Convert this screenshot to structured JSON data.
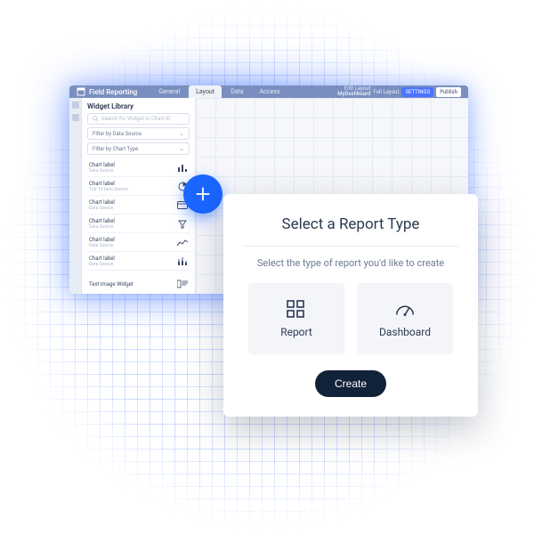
{
  "app": {
    "title": "Field Reporting",
    "tabs": [
      "General",
      "Layout",
      "Data",
      "Access"
    ],
    "active_tab": "Layout",
    "workspace": {
      "label_top": "Edit Layout",
      "name": "MyDashboard"
    },
    "header_buttons": {
      "full": "Full Layout",
      "settings": "SETTINGS",
      "publish": "Publish"
    }
  },
  "sidebar": {
    "title": "Widget Library",
    "search_placeholder": "Search for Widget or Chart ID",
    "filter_source": "Filter by Data Source",
    "filter_chart": "Filter by Chart Type",
    "items": [
      {
        "label": "Chart label",
        "sub": "Data Source",
        "icon": "bar"
      },
      {
        "label": "Chart label",
        "sub": "Top 10 Data Source",
        "icon": "pie"
      },
      {
        "label": "Chart label",
        "sub": "Data Source",
        "icon": "card"
      },
      {
        "label": "Chart label",
        "sub": "Data Source",
        "icon": "funnel"
      },
      {
        "label": "Chart label",
        "sub": "Data Source",
        "icon": "line"
      },
      {
        "label": "Chart label",
        "sub": "Data Source",
        "icon": "stack"
      }
    ],
    "text_widget": "Text Image Widget"
  },
  "fab": {
    "name": "add"
  },
  "modal": {
    "title": "Select a Report Type",
    "subtitle": "Select the type of report you'd like to create",
    "options": [
      {
        "key": "report",
        "label": "Report"
      },
      {
        "key": "dashboard",
        "label": "Dashboard"
      }
    ],
    "create": "Create"
  }
}
